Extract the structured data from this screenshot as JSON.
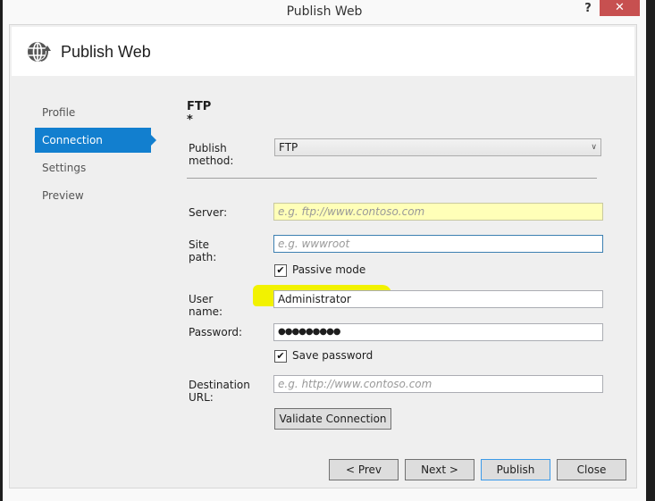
{
  "window": {
    "title": "Publish Web",
    "help_label": "?",
    "close_label": "✕"
  },
  "header": {
    "icon": "globe-publish-icon",
    "title": "Publish Web"
  },
  "nav": {
    "items": [
      {
        "label": "Profile",
        "active": false
      },
      {
        "label": "Connection",
        "active": true
      },
      {
        "label": "Settings",
        "active": false
      },
      {
        "label": "Preview",
        "active": false
      }
    ]
  },
  "form": {
    "section_title": "FTP *",
    "publish_method": {
      "label": "Publish method:",
      "value": "FTP"
    },
    "server": {
      "label": "Server:",
      "value": "",
      "placeholder": "e.g. ftp://www.contoso.com"
    },
    "site_path": {
      "label": "Site path:",
      "value": "",
      "placeholder": "e.g. wwwroot"
    },
    "passive_mode": {
      "label": "Passive mode",
      "checked": true
    },
    "user_name": {
      "label": "User name:",
      "value": "Administrator"
    },
    "password": {
      "label": "Password:",
      "value": "●●●●●●●●●"
    },
    "save_password": {
      "label": "Save password",
      "checked": true
    },
    "destination_url": {
      "label": "Destination URL:",
      "value": "",
      "placeholder": "e.g. http://www.contoso.com"
    },
    "validate_label": "Validate Connection"
  },
  "footer": {
    "prev_label": "< Prev",
    "next_label": "Next >",
    "publish_label": "Publish",
    "close_label": "Close"
  },
  "colors": {
    "accent": "#127fcf",
    "close_button": "#c75050",
    "highlight": "#f2f200",
    "server_field_bg": "#ffffb8"
  }
}
